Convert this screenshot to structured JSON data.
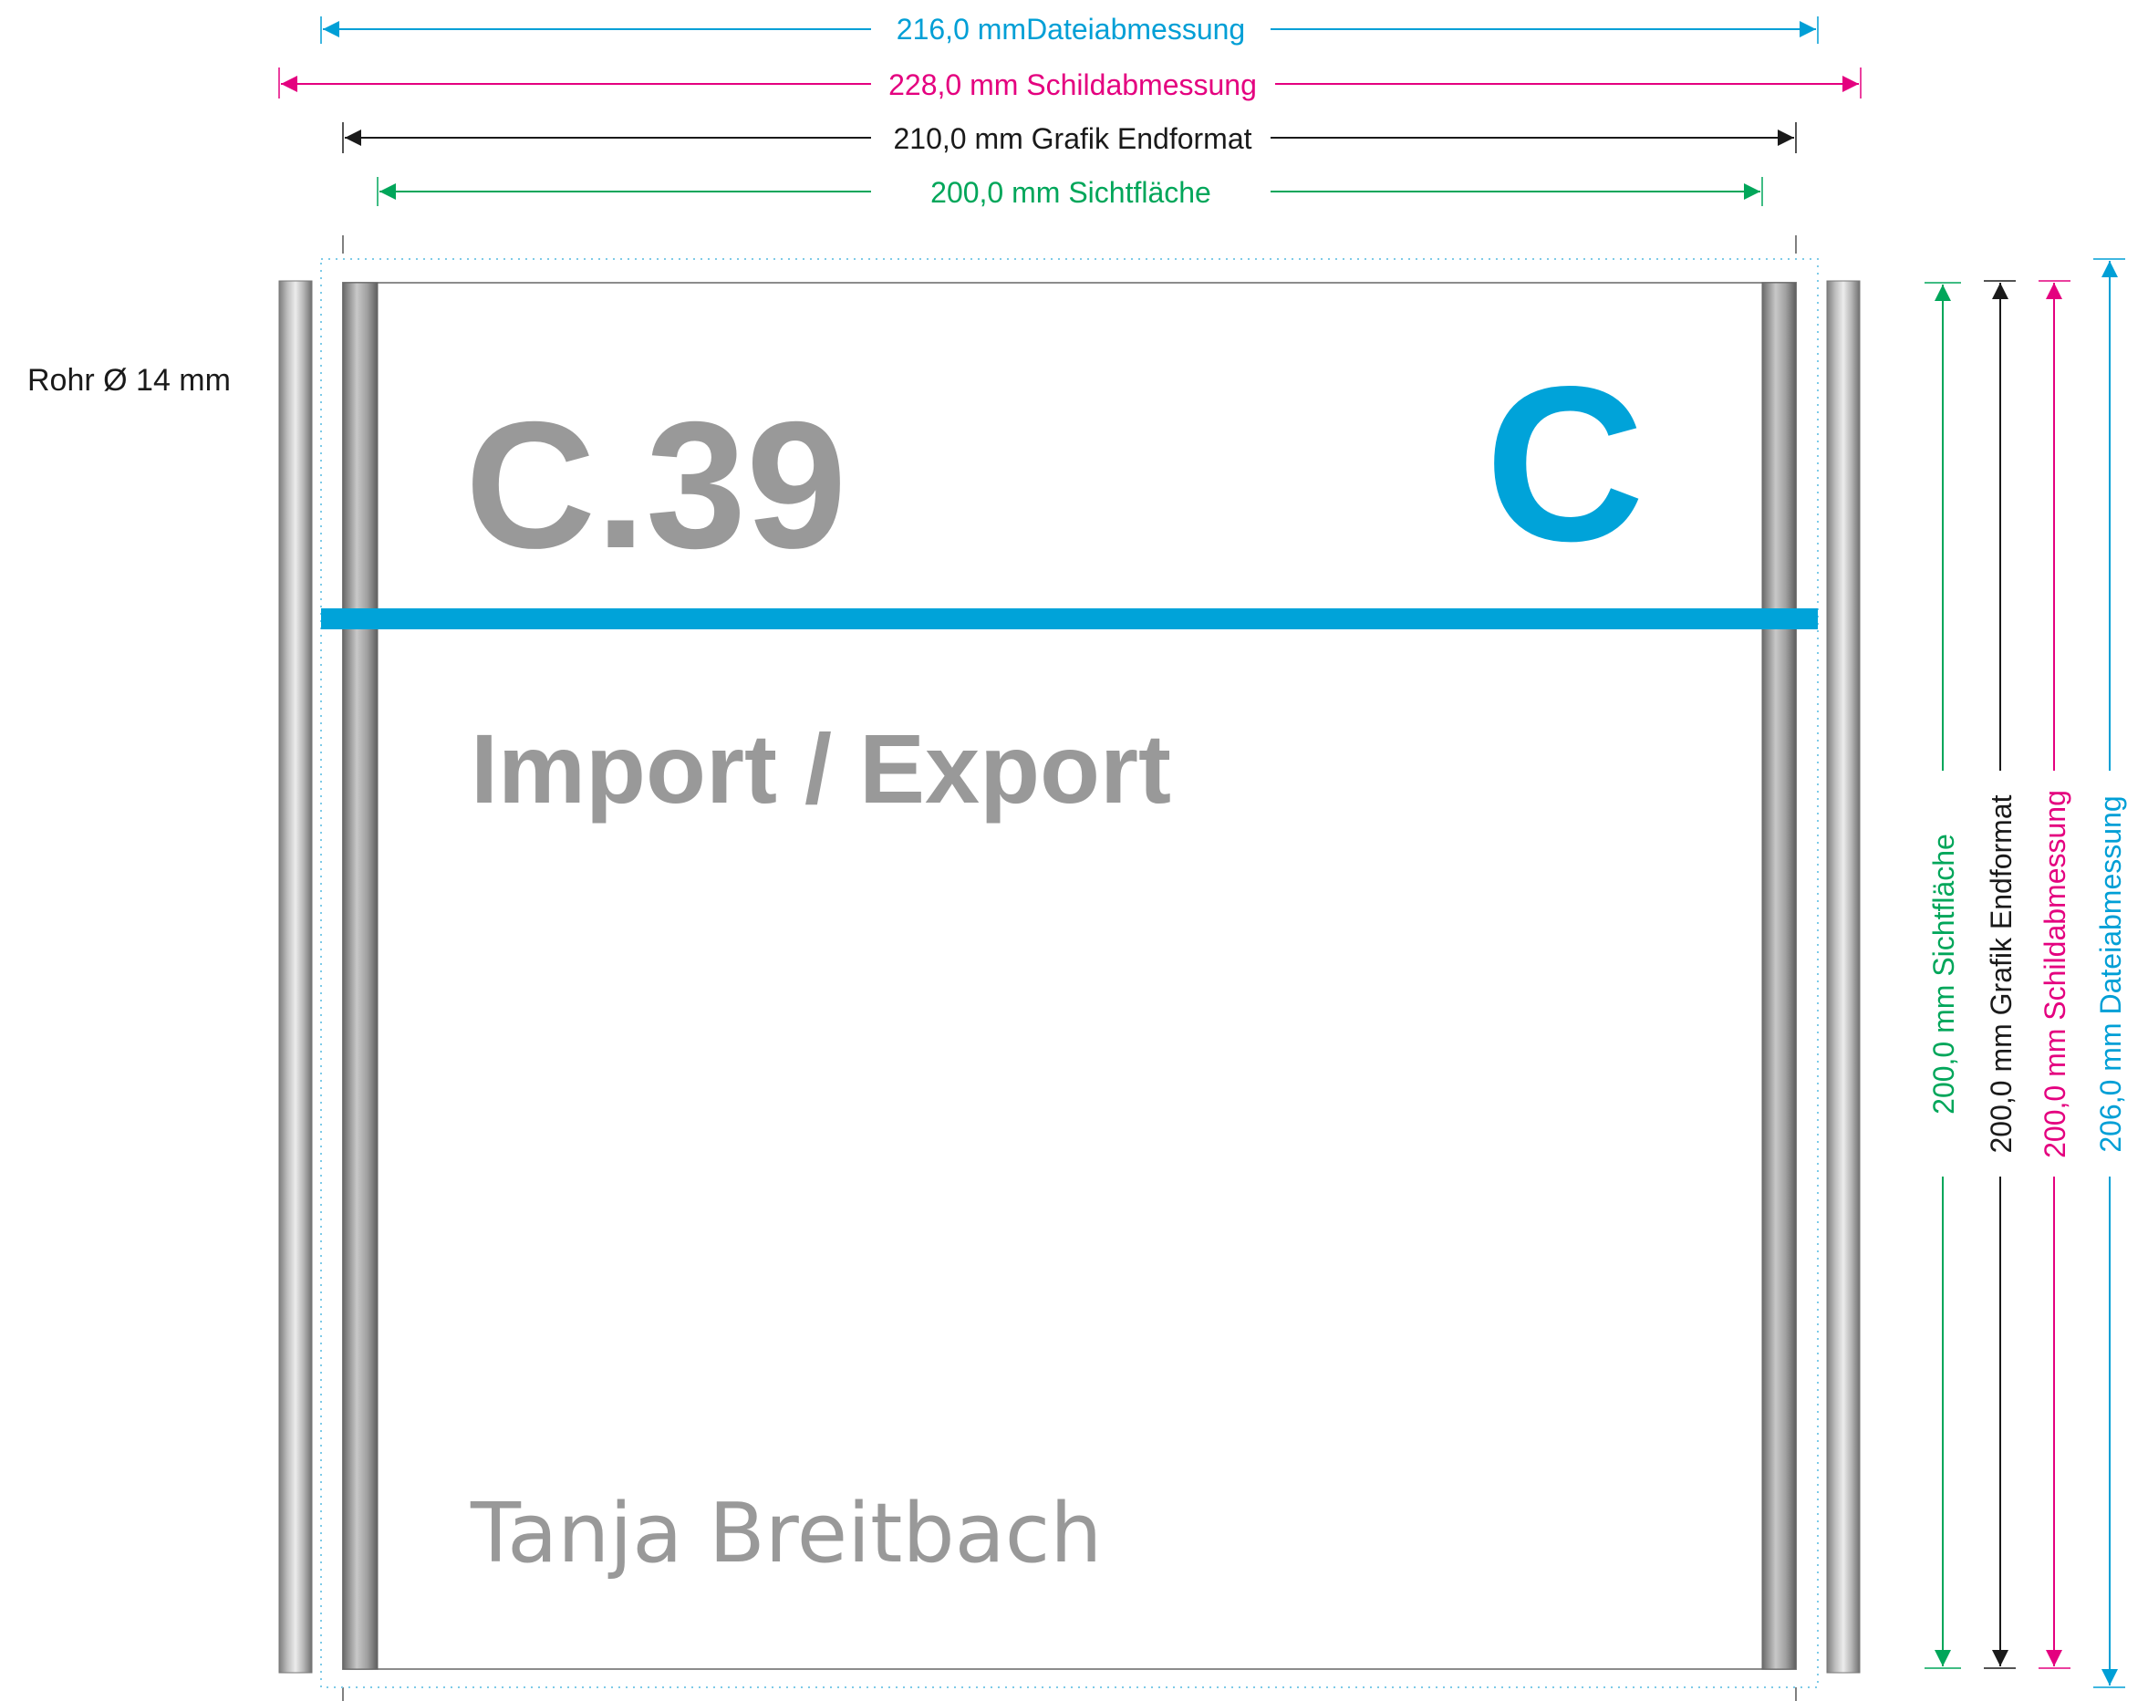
{
  "colors": {
    "cyan": "#009fd6",
    "magenta": "#e4007f",
    "black": "#1a1a1a",
    "green": "#00a65a",
    "sign_text_gray": "#999999",
    "accent_bar": "#00a3d9"
  },
  "dimensions": {
    "horizontal": {
      "file": "216,0 mmDateiabmessung",
      "sign": "228,0 mm Schildabmessung",
      "graphic": "210,0 mm Grafik Endformat",
      "visible": "200,0 mm Sichtfläche"
    },
    "vertical": {
      "visible": "200,0 mm Sichtfläche",
      "graphic": "200,0 mm Grafik Endformat",
      "sign": "200,0 mm Schildabmessung",
      "file": "206,0 mm Dateiabmessung"
    },
    "tube_label": "Rohr Ø 14 mm"
  },
  "sign": {
    "room_number": "C.39",
    "section_letter": "C",
    "department": "Import / Export",
    "person": "Tanja Breitbach"
  }
}
